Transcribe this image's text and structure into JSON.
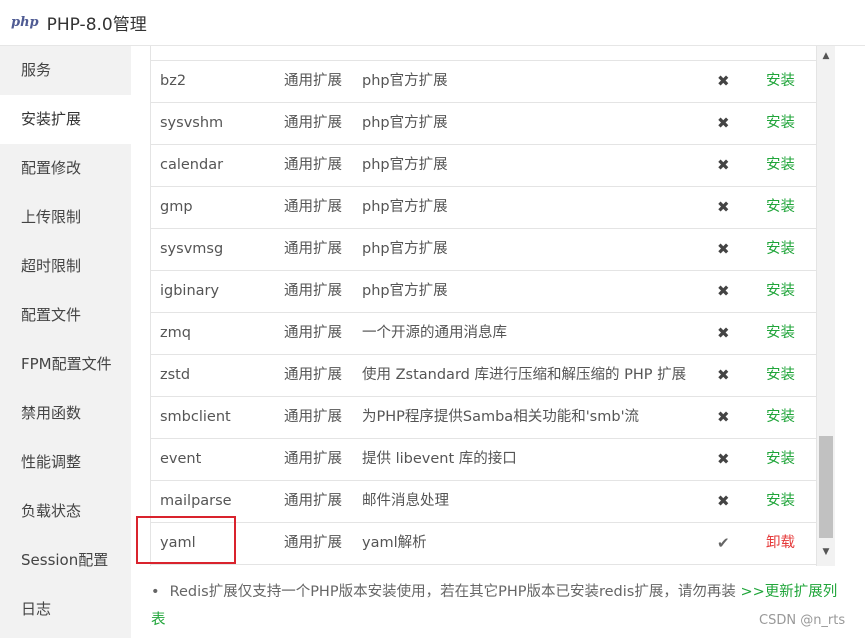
{
  "window": {
    "logo_text": "php",
    "title": "PHP-8.0管理"
  },
  "sidebar": {
    "items": [
      {
        "label": "服务",
        "active": false
      },
      {
        "label": "安装扩展",
        "active": true
      },
      {
        "label": "配置修改",
        "active": false
      },
      {
        "label": "上传限制",
        "active": false
      },
      {
        "label": "超时限制",
        "active": false
      },
      {
        "label": "配置文件",
        "active": false
      },
      {
        "label": "FPM配置文件",
        "active": false
      },
      {
        "label": "禁用函数",
        "active": false
      },
      {
        "label": "性能调整",
        "active": false
      },
      {
        "label": "负载状态",
        "active": false
      },
      {
        "label": "Session配置",
        "active": false
      },
      {
        "label": "日志",
        "active": false
      }
    ]
  },
  "extensions": {
    "rows": [
      {
        "name": "bz2",
        "type": "通用扩展",
        "desc": "php官方扩展",
        "status": "✖",
        "action": "安装"
      },
      {
        "name": "sysvshm",
        "type": "通用扩展",
        "desc": "php官方扩展",
        "status": "✖",
        "action": "安装"
      },
      {
        "name": "calendar",
        "type": "通用扩展",
        "desc": "php官方扩展",
        "status": "✖",
        "action": "安装"
      },
      {
        "name": "gmp",
        "type": "通用扩展",
        "desc": "php官方扩展",
        "status": "✖",
        "action": "安装"
      },
      {
        "name": "sysvmsg",
        "type": "通用扩展",
        "desc": "php官方扩展",
        "status": "✖",
        "action": "安装"
      },
      {
        "name": "igbinary",
        "type": "通用扩展",
        "desc": "php官方扩展",
        "status": "✖",
        "action": "安装"
      },
      {
        "name": "zmq",
        "type": "通用扩展",
        "desc": "一个开源的通用消息库",
        "status": "✖",
        "action": "安装"
      },
      {
        "name": "zstd",
        "type": "通用扩展",
        "desc": "使用 Zstandard 库进行压缩和解压缩的 PHP 扩展",
        "status": "✖",
        "action": "安装"
      },
      {
        "name": "smbclient",
        "type": "通用扩展",
        "desc": "为PHP程序提供Samba相关功能和'smb'流",
        "status": "✖",
        "action": "安装"
      },
      {
        "name": "event",
        "type": "通用扩展",
        "desc": "提供 libevent 库的接口",
        "status": "✖",
        "action": "安装"
      },
      {
        "name": "mailparse",
        "type": "通用扩展",
        "desc": "邮件消息处理",
        "status": "✖",
        "action": "安装"
      },
      {
        "name": "yaml",
        "type": "通用扩展",
        "desc": "yaml解析",
        "status": "✔",
        "action": "卸载"
      }
    ]
  },
  "note": {
    "bullet": "•",
    "text": "Redis扩展仅支持一个PHP版本安装使用，若在其它PHP版本已安装redis扩展，请勿再装",
    "link": ">>更新扩展列表"
  },
  "scrollbar": {
    "up": "▲",
    "down": "▼"
  },
  "watermark": "CSDN @n_rts",
  "colors": {
    "install": "#20a53a",
    "uninstall": "#e53a3a",
    "highlight": "#d9232d",
    "sidebar_bg": "#f2f2f2"
  }
}
